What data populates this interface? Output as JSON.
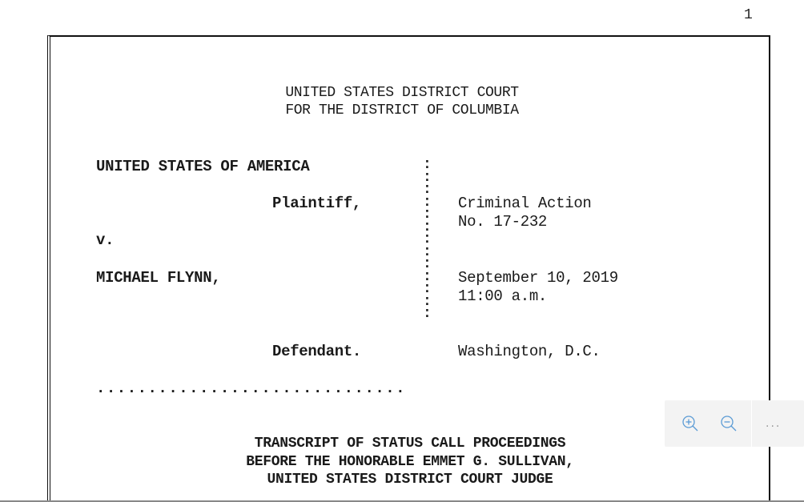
{
  "page": {
    "number": "1"
  },
  "court": {
    "line1": "UNITED STATES DISTRICT COURT",
    "line2": "FOR THE DISTRICT OF COLUMBIA"
  },
  "caption": {
    "plaintiff_name": "UNITED STATES OF AMERICA",
    "plaintiff_role": "Plaintiff,",
    "versus": "v.",
    "defendant_name": "MICHAEL FLYNN,",
    "defendant_role": "Defendant.",
    "dots": "..............................",
    "colon": ":",
    "colon_count": 13
  },
  "case_info": {
    "action_label": "Criminal Action",
    "action_number": "No. 17-232",
    "date": "September 10, 2019",
    "time": "11:00 a.m.",
    "location": "Washington, D.C."
  },
  "transcript": {
    "line1": "TRANSCRIPT OF STATUS CALL PROCEEDINGS",
    "line2": "BEFORE THE HONORABLE EMMET G. SULLIVAN,",
    "line3": "UNITED STATES DISTRICT COURT JUDGE"
  },
  "toolbar": {
    "zoom_in_icon": "zoom-in-icon",
    "zoom_out_icon": "zoom-out-icon",
    "more_label": "...",
    "icon_color": "#5b9bd5"
  }
}
